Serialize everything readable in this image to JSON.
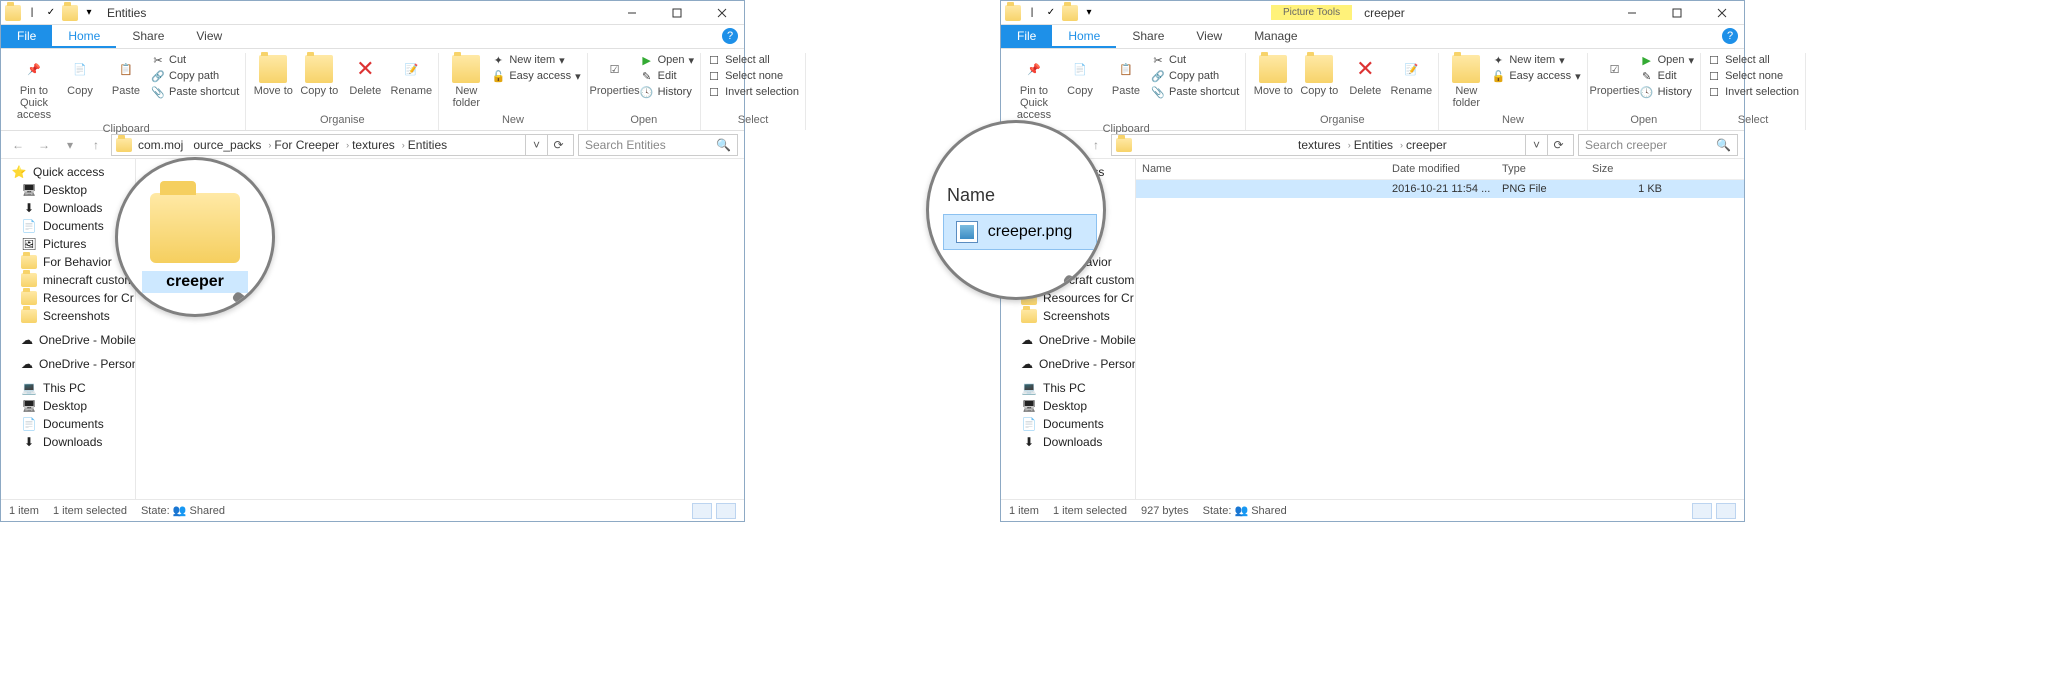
{
  "left": {
    "title": "Entities",
    "tabs": {
      "file": "File",
      "home": "Home",
      "share": "Share",
      "view": "View"
    },
    "ribbon": {
      "clipboard": {
        "pin": "Pin to Quick access",
        "copy": "Copy",
        "paste": "Paste",
        "cut": "Cut",
        "copyPath": "Copy path",
        "pasteShortcut": "Paste shortcut",
        "label": "Clipboard"
      },
      "organise": {
        "move": "Move to",
        "copy": "Copy to",
        "delete": "Delete",
        "rename": "Rename",
        "label": "Organise"
      },
      "new": {
        "folder": "New folder",
        "item": "New item",
        "easy": "Easy access",
        "label": "New"
      },
      "open": {
        "props": "Properties",
        "open": "Open",
        "edit": "Edit",
        "history": "History",
        "label": "Open"
      },
      "select": {
        "all": "Select all",
        "none": "Select none",
        "invert": "Invert selection",
        "label": "Select"
      }
    },
    "breadcrumbs": [
      "com.moj",
      "ource_packs",
      "For Creeper",
      "textures",
      "Entities"
    ],
    "searchPlaceholder": "Search Entities",
    "sidebar": [
      {
        "label": "Quick access",
        "type": "star"
      },
      {
        "label": "Desktop",
        "type": "desktop"
      },
      {
        "label": "Downloads",
        "type": "down"
      },
      {
        "label": "Documents",
        "type": "doc"
      },
      {
        "label": "Pictures",
        "type": "pic"
      },
      {
        "label": "For Behavior",
        "type": "folder"
      },
      {
        "label": "minecraft custom",
        "type": "folder"
      },
      {
        "label": "Resources for Cr",
        "type": "folder"
      },
      {
        "label": "Screenshots",
        "type": "folder"
      },
      {
        "gap": true
      },
      {
        "label": "OneDrive - Mobile",
        "type": "cloud"
      },
      {
        "gap": true
      },
      {
        "label": "OneDrive - Person",
        "type": "cloud"
      },
      {
        "gap": true
      },
      {
        "label": "This PC",
        "type": "pc"
      },
      {
        "label": "Desktop",
        "type": "desktop"
      },
      {
        "label": "Documents",
        "type": "doc"
      },
      {
        "label": "Downloads",
        "type": "down"
      }
    ],
    "magnifier": {
      "folderName": "creeper"
    },
    "status": {
      "count": "1 item",
      "selected": "1 item selected",
      "state": "State:",
      "shared": "Shared"
    }
  },
  "right": {
    "title": "creeper",
    "context": {
      "top": "Picture Tools",
      "bot": "Manage"
    },
    "breadcrumbs": [
      "textures",
      "Entities",
      "creeper"
    ],
    "searchPlaceholder": "Search creeper",
    "columns": {
      "name": "Name",
      "date": "Date modified",
      "type": "Type",
      "size": "Size"
    },
    "file": {
      "name": "creeper.png",
      "date": "2016-10-21 11:54 ...",
      "type": "PNG File",
      "size": "1 KB"
    },
    "magnifier": {
      "header": "Name",
      "file": "creeper.png"
    },
    "status": {
      "count": "1 item",
      "selected": "1 item selected",
      "bytes": "927 bytes",
      "state": "State:",
      "shared": "Shared"
    }
  }
}
